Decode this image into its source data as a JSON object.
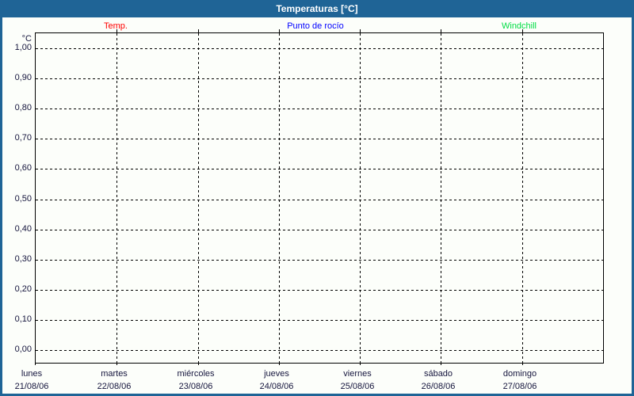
{
  "window": {
    "title": "Temperaturas [°C]"
  },
  "colors": {
    "frame": "#1f6496",
    "title_text": "#ffffff",
    "background": "#fcfefa",
    "grid": "#000000",
    "axis_label_text": "#15153d",
    "temp_series": "#ff0000",
    "dewpoint_series": "#0000ff",
    "windchill_series": "#00dd44"
  },
  "legend": [
    {
      "label": "Temp.",
      "color": "#ff0000"
    },
    {
      "label": "Punto de rocío",
      "color": "#0000ff"
    },
    {
      "label": "Windchill",
      "color": "#00dd44"
    }
  ],
  "y_axis": {
    "unit_label": "°C",
    "tick_labels": [
      "1,00",
      "0,90",
      "0,80",
      "0,70",
      "0,60",
      "0,50",
      "0,40",
      "0,30",
      "0,20",
      "0,10",
      "0,00"
    ]
  },
  "x_axis": {
    "days": [
      {
        "name": "lunes",
        "date": "21/08/06"
      },
      {
        "name": "martes",
        "date": "22/08/06"
      },
      {
        "name": "miércoles",
        "date": "23/08/06"
      },
      {
        "name": "jueves",
        "date": "24/08/06"
      },
      {
        "name": "viernes",
        "date": "25/08/06"
      },
      {
        "name": "sábado",
        "date": "26/08/06"
      },
      {
        "name": "domingo",
        "date": "27/08/06"
      }
    ]
  },
  "chart_data": {
    "type": "line",
    "title": "Temperaturas [°C]",
    "ylabel": "°C",
    "ylim": [
      0.0,
      1.0
    ],
    "ytick_step": 0.1,
    "grid": "dashed",
    "legend_position": "top",
    "categories": [
      "lunes 21/08/06",
      "martes 22/08/06",
      "miércoles 23/08/06",
      "jueves 24/08/06",
      "viernes 25/08/06",
      "sábado 26/08/06",
      "domingo 27/08/06"
    ],
    "series": [
      {
        "name": "Temp.",
        "color": "#ff0000",
        "values": []
      },
      {
        "name": "Punto de rocío",
        "color": "#0000ff",
        "values": []
      },
      {
        "name": "Windchill",
        "color": "#00dd44",
        "values": []
      }
    ]
  }
}
